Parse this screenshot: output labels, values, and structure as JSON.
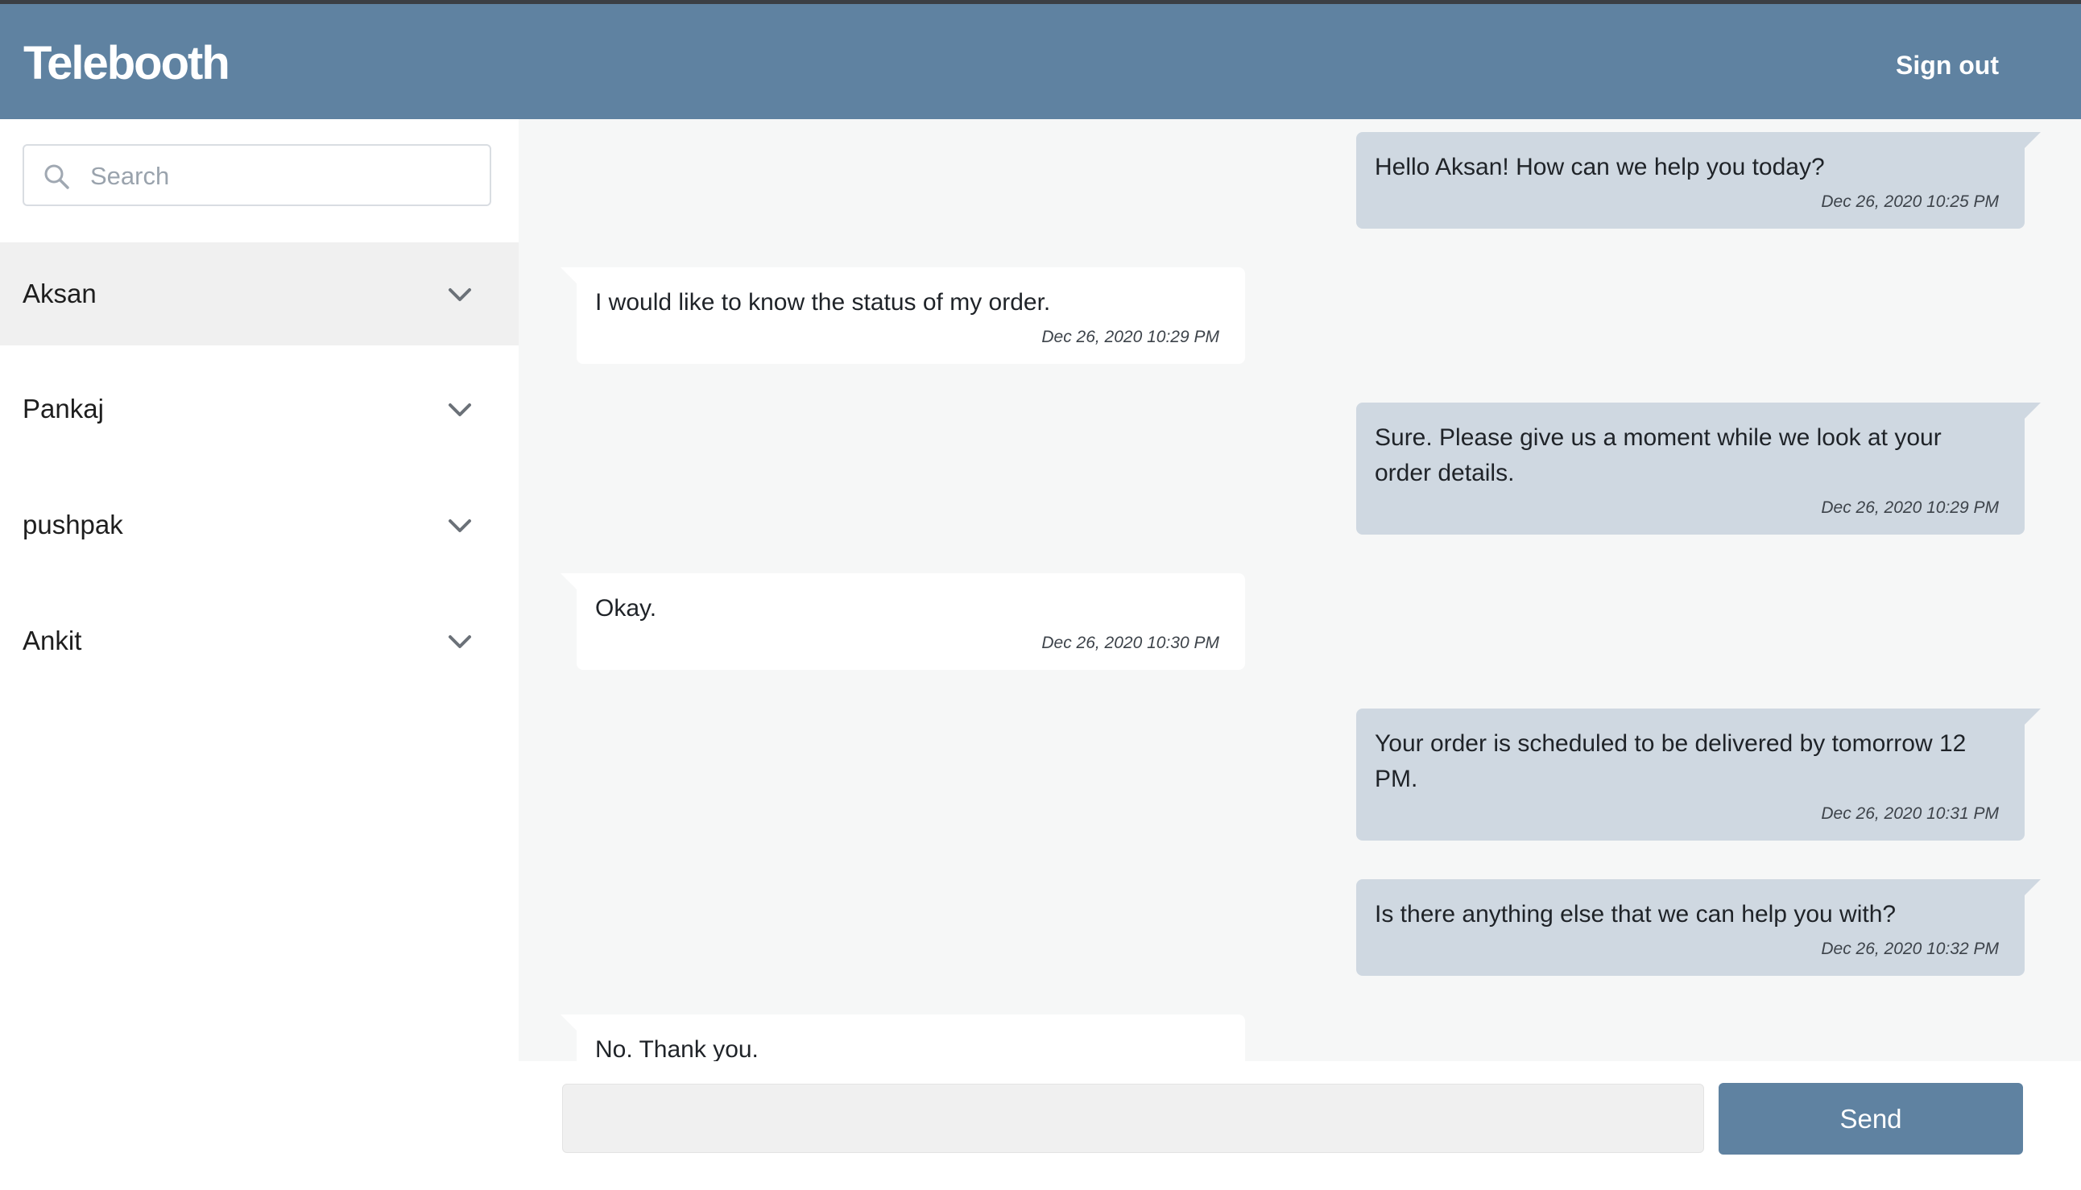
{
  "header": {
    "brand": "Telebooth",
    "signout_label": "Sign out"
  },
  "sidebar": {
    "search_placeholder": "Search",
    "search_icon": "search-icon",
    "contacts": [
      {
        "name": "Aksan",
        "active": true,
        "icon": "chevron-down-icon"
      },
      {
        "name": "Pankaj",
        "active": false,
        "icon": "chevron-down-icon"
      },
      {
        "name": "pushpak",
        "active": false,
        "icon": "chevron-down-icon"
      },
      {
        "name": "Ankit",
        "active": false,
        "icon": "chevron-down-icon"
      }
    ]
  },
  "chat": {
    "messages": [
      {
        "direction": "out",
        "text": "Hello Aksan! How can we help you today?",
        "time": "Dec 26, 2020 10:25 PM"
      },
      {
        "direction": "in",
        "text": "I would like to know the status of my order.",
        "time": "Dec 26, 2020 10:29 PM"
      },
      {
        "direction": "out",
        "text": "Sure. Please give us a moment while we look at your order details.",
        "time": "Dec 26, 2020 10:29 PM"
      },
      {
        "direction": "in",
        "text": "Okay.",
        "time": "Dec 26, 2020 10:30 PM"
      },
      {
        "direction": "out",
        "text": "Your order is scheduled to be delivered by tomorrow 12 PM.",
        "time": "Dec 26, 2020 10:31 PM"
      },
      {
        "direction": "out",
        "text": "Is there anything else that we can help you with?",
        "time": "Dec 26, 2020 10:32 PM"
      },
      {
        "direction": "in",
        "text": "No. Thank you.",
        "time": ""
      }
    ]
  },
  "composer": {
    "input_value": "",
    "send_label": "Send"
  },
  "colors": {
    "header_bg": "#5f82a1",
    "outgoing_bubble": "#cfd8e1",
    "incoming_bubble": "#ffffff",
    "chat_bg": "#f6f7f7",
    "active_contact_bg": "#f0f0f0"
  }
}
